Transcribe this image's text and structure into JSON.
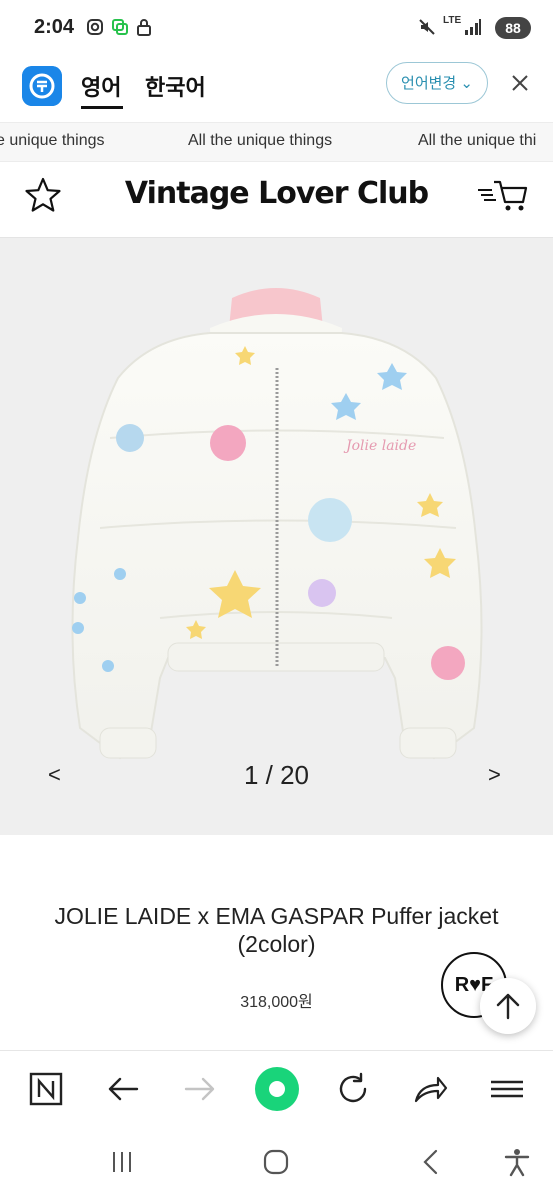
{
  "status_bar": {
    "time": "2:04",
    "network": "LTE",
    "battery": "88",
    "icons": [
      "instagram-icon",
      "messenger-icon",
      "lock-icon",
      "mute-icon",
      "signal-icon"
    ]
  },
  "translate_bar": {
    "tabs": [
      {
        "label": "영어",
        "active": true
      },
      {
        "label": "한국어",
        "active": false
      }
    ],
    "language_button": "언어변경",
    "colors": {
      "accent": "#2a8fb0",
      "logo": "#1a86e8"
    }
  },
  "marquee": {
    "items": [
      "e unique things",
      "All the unique things",
      "All the unique thi"
    ]
  },
  "header": {
    "brand": "Vintage Lover Club"
  },
  "gallery": {
    "current": "1 / 20",
    "prev_label": "<",
    "next_label": ">",
    "jacket_text": "Jolie laide"
  },
  "product": {
    "name": "JOLIE LAIDE x EMA GASPAR Puffer jacket (2color)",
    "price": "318,000원",
    "badge": "R♥F"
  },
  "browser_bar": {
    "buttons": [
      "n-icon",
      "back-arrow-icon",
      "forward-arrow-icon",
      "home-circle-icon",
      "refresh-icon",
      "share-icon",
      "menu-icon"
    ],
    "accent": "#19d47a"
  },
  "nav_bar": {
    "buttons": [
      "recents-icon",
      "home-icon",
      "back-icon",
      "accessibility-icon"
    ]
  }
}
